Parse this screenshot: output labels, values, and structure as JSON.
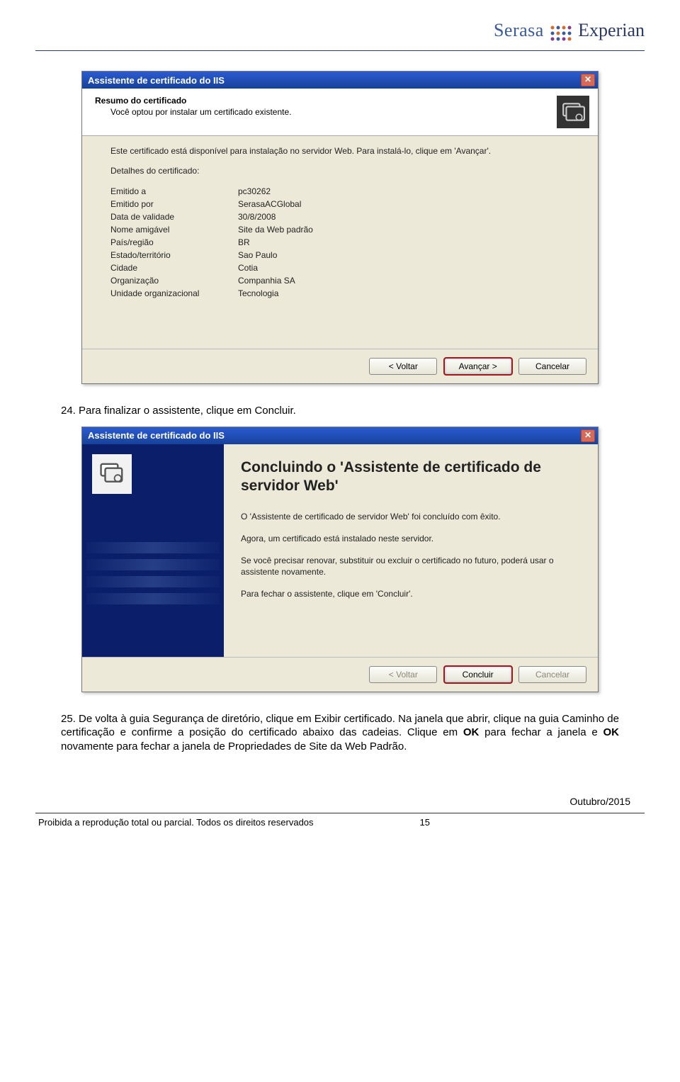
{
  "logo": {
    "serasa": "Serasa",
    "experian": "Experian"
  },
  "step24": {
    "text": "24. Para finalizar o assistente, clique em Concluir."
  },
  "step25": {
    "prefix": "25. De volta à guia Segurança de diretório, clique em Exibir certificado. Na janela que abrir, clique na guia Caminho de certificação e confirme a posição do certificado abaixo das cadeias. Clique em ",
    "bold1": "OK",
    "mid": " para fechar a janela e ",
    "bold2": "OK",
    "suffix": " novamente para fechar a janela de Propriedades de Site da Web Padrão."
  },
  "dialog1": {
    "title": "Assistente de certificado do IIS",
    "header_title": "Resumo do certificado",
    "header_sub": "Você optou por instalar um certificado existente.",
    "intro": "Este certificado está disponível para instalação no servidor Web. Para instalá-lo, clique em 'Avançar'.",
    "details_heading": "Detalhes do certificado:",
    "rows": [
      {
        "label": "Emitido a",
        "value": "pc30262"
      },
      {
        "label": "Emitido por",
        "value": "SerasaACGlobal"
      },
      {
        "label": "Data de validade",
        "value": "30/8/2008"
      },
      {
        "label": "Nome amigável",
        "value": "Site da Web padrão"
      },
      {
        "label": "País/região",
        "value": "BR"
      },
      {
        "label": "Estado/território",
        "value": "Sao Paulo"
      },
      {
        "label": "Cidade",
        "value": "Cotia"
      },
      {
        "label": "Organização",
        "value": "Companhia SA"
      },
      {
        "label": "Unidade organizacional",
        "value": "Tecnologia"
      }
    ],
    "back": "< Voltar",
    "next": "Avançar >",
    "cancel": "Cancelar"
  },
  "dialog2": {
    "title": "Assistente de certificado do IIS",
    "heading": "Concluindo o 'Assistente de certificado de servidor Web'",
    "p1": "O 'Assistente de certificado de servidor Web' foi concluído com êxito.",
    "p2": "Agora, um certificado está instalado neste servidor.",
    "p3": "Se você precisar renovar, substituir ou excluir o certificado no futuro, poderá usar o assistente novamente.",
    "p4": "Para fechar o assistente, clique em 'Concluir'.",
    "back": "< Voltar",
    "finish": "Concluir",
    "cancel": "Cancelar"
  },
  "footer": {
    "date": "Outubro/2015",
    "copyright": "Proibida a reprodução total ou parcial. Todos os direitos reservados",
    "page": "15"
  }
}
